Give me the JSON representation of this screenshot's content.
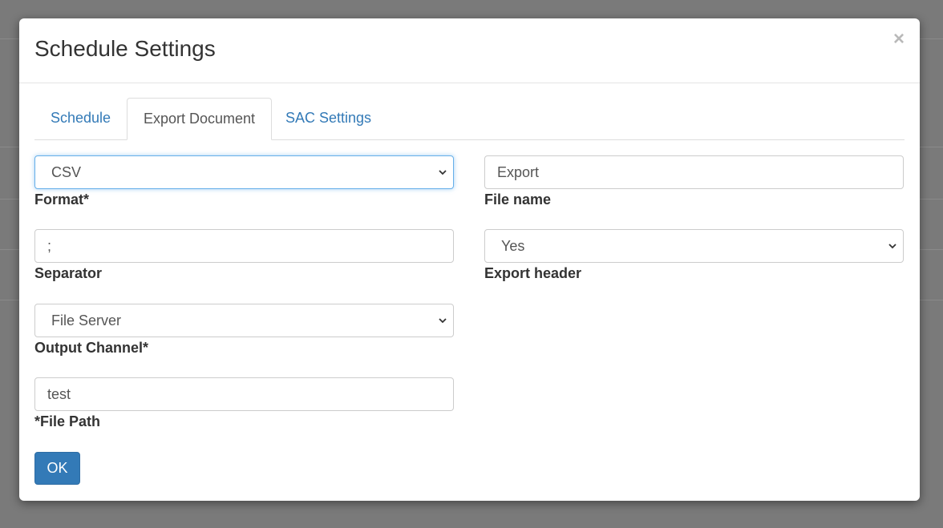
{
  "modal": {
    "title": "Schedule Settings",
    "close_symbol": "×"
  },
  "tabs": [
    {
      "label": "Schedule",
      "active": false
    },
    {
      "label": "Export Document",
      "active": true
    },
    {
      "label": "SAC Settings",
      "active": false
    }
  ],
  "form": {
    "format": {
      "value": "CSV",
      "label": "Format*"
    },
    "file_name": {
      "value": "Export",
      "label": "File name"
    },
    "separator": {
      "value": ";",
      "label": "Separator"
    },
    "export_header": {
      "value": "Yes",
      "label": "Export header"
    },
    "output_channel": {
      "value": "File Server",
      "label": "Output Channel*"
    },
    "file_path": {
      "value": "test",
      "label": "*File Path"
    }
  },
  "actions": {
    "ok_label": "OK"
  },
  "icons": {
    "close": "close-icon",
    "dropdown": "chevron-down-icon"
  },
  "colors": {
    "link": "#337ab7",
    "primary_button": "#337ab7",
    "focus_border": "#66afe9",
    "backdrop": "#7a7a7a"
  }
}
